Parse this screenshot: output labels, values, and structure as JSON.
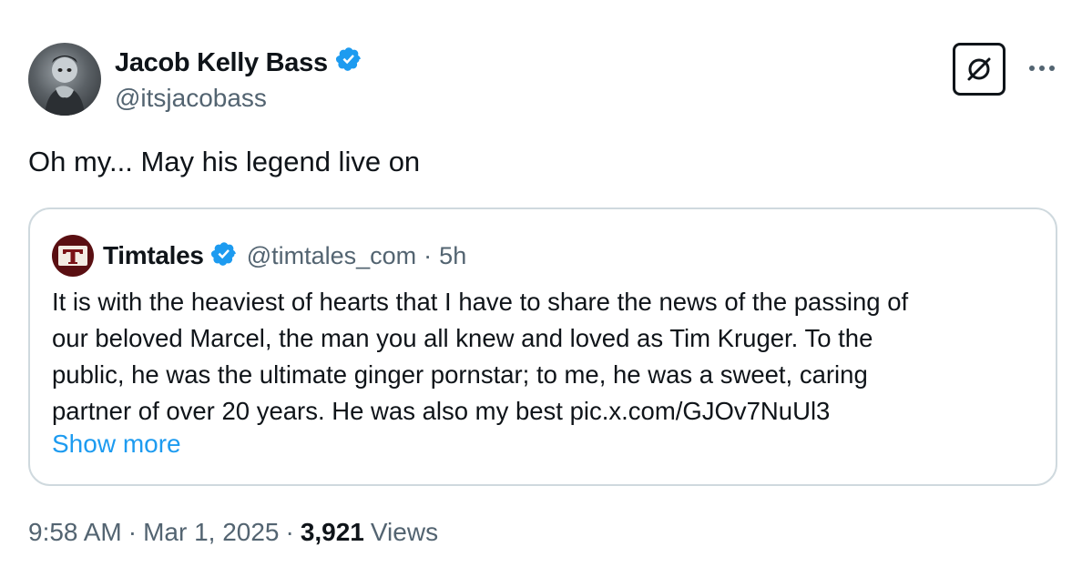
{
  "author": {
    "name": "Jacob Kelly Bass",
    "handle": "@itsjacobass",
    "verified": true,
    "avatar_icon": "user-avatar-photo"
  },
  "actions": {
    "grok_icon": "grok-slash-circle-icon",
    "more_icon": "more-horizontal-icon"
  },
  "tweet": {
    "text": "Oh my... May his legend live on"
  },
  "quote": {
    "name": "Timtales",
    "handle": "@timtales_com",
    "separator": "·",
    "time": "5h",
    "verified": true,
    "avatar_letter": "T",
    "body_lines": [
      "It is with the heaviest of hearts that I have to share the news of the passing of",
      "our beloved Marcel, the man you all knew and loved as Tim Kruger. To the",
      "public, he was the ultimate ginger pornstar; to me, he was a sweet, caring",
      "partner of over 20 years. He was also my best pic.x.com/GJOv7NuUl3"
    ],
    "show_more": "Show more"
  },
  "meta": {
    "time": "9:58 AM",
    "separator": "·",
    "date": "Mar 1, 2025",
    "views_count": "3,921",
    "views_label": "Views"
  },
  "colors": {
    "text": "#0f1419",
    "secondary": "#536471",
    "link": "#1d9bf0",
    "verified": "#1d9bf0",
    "border": "#cfd9de",
    "quote_avatar_bg": "#5a0f12"
  }
}
